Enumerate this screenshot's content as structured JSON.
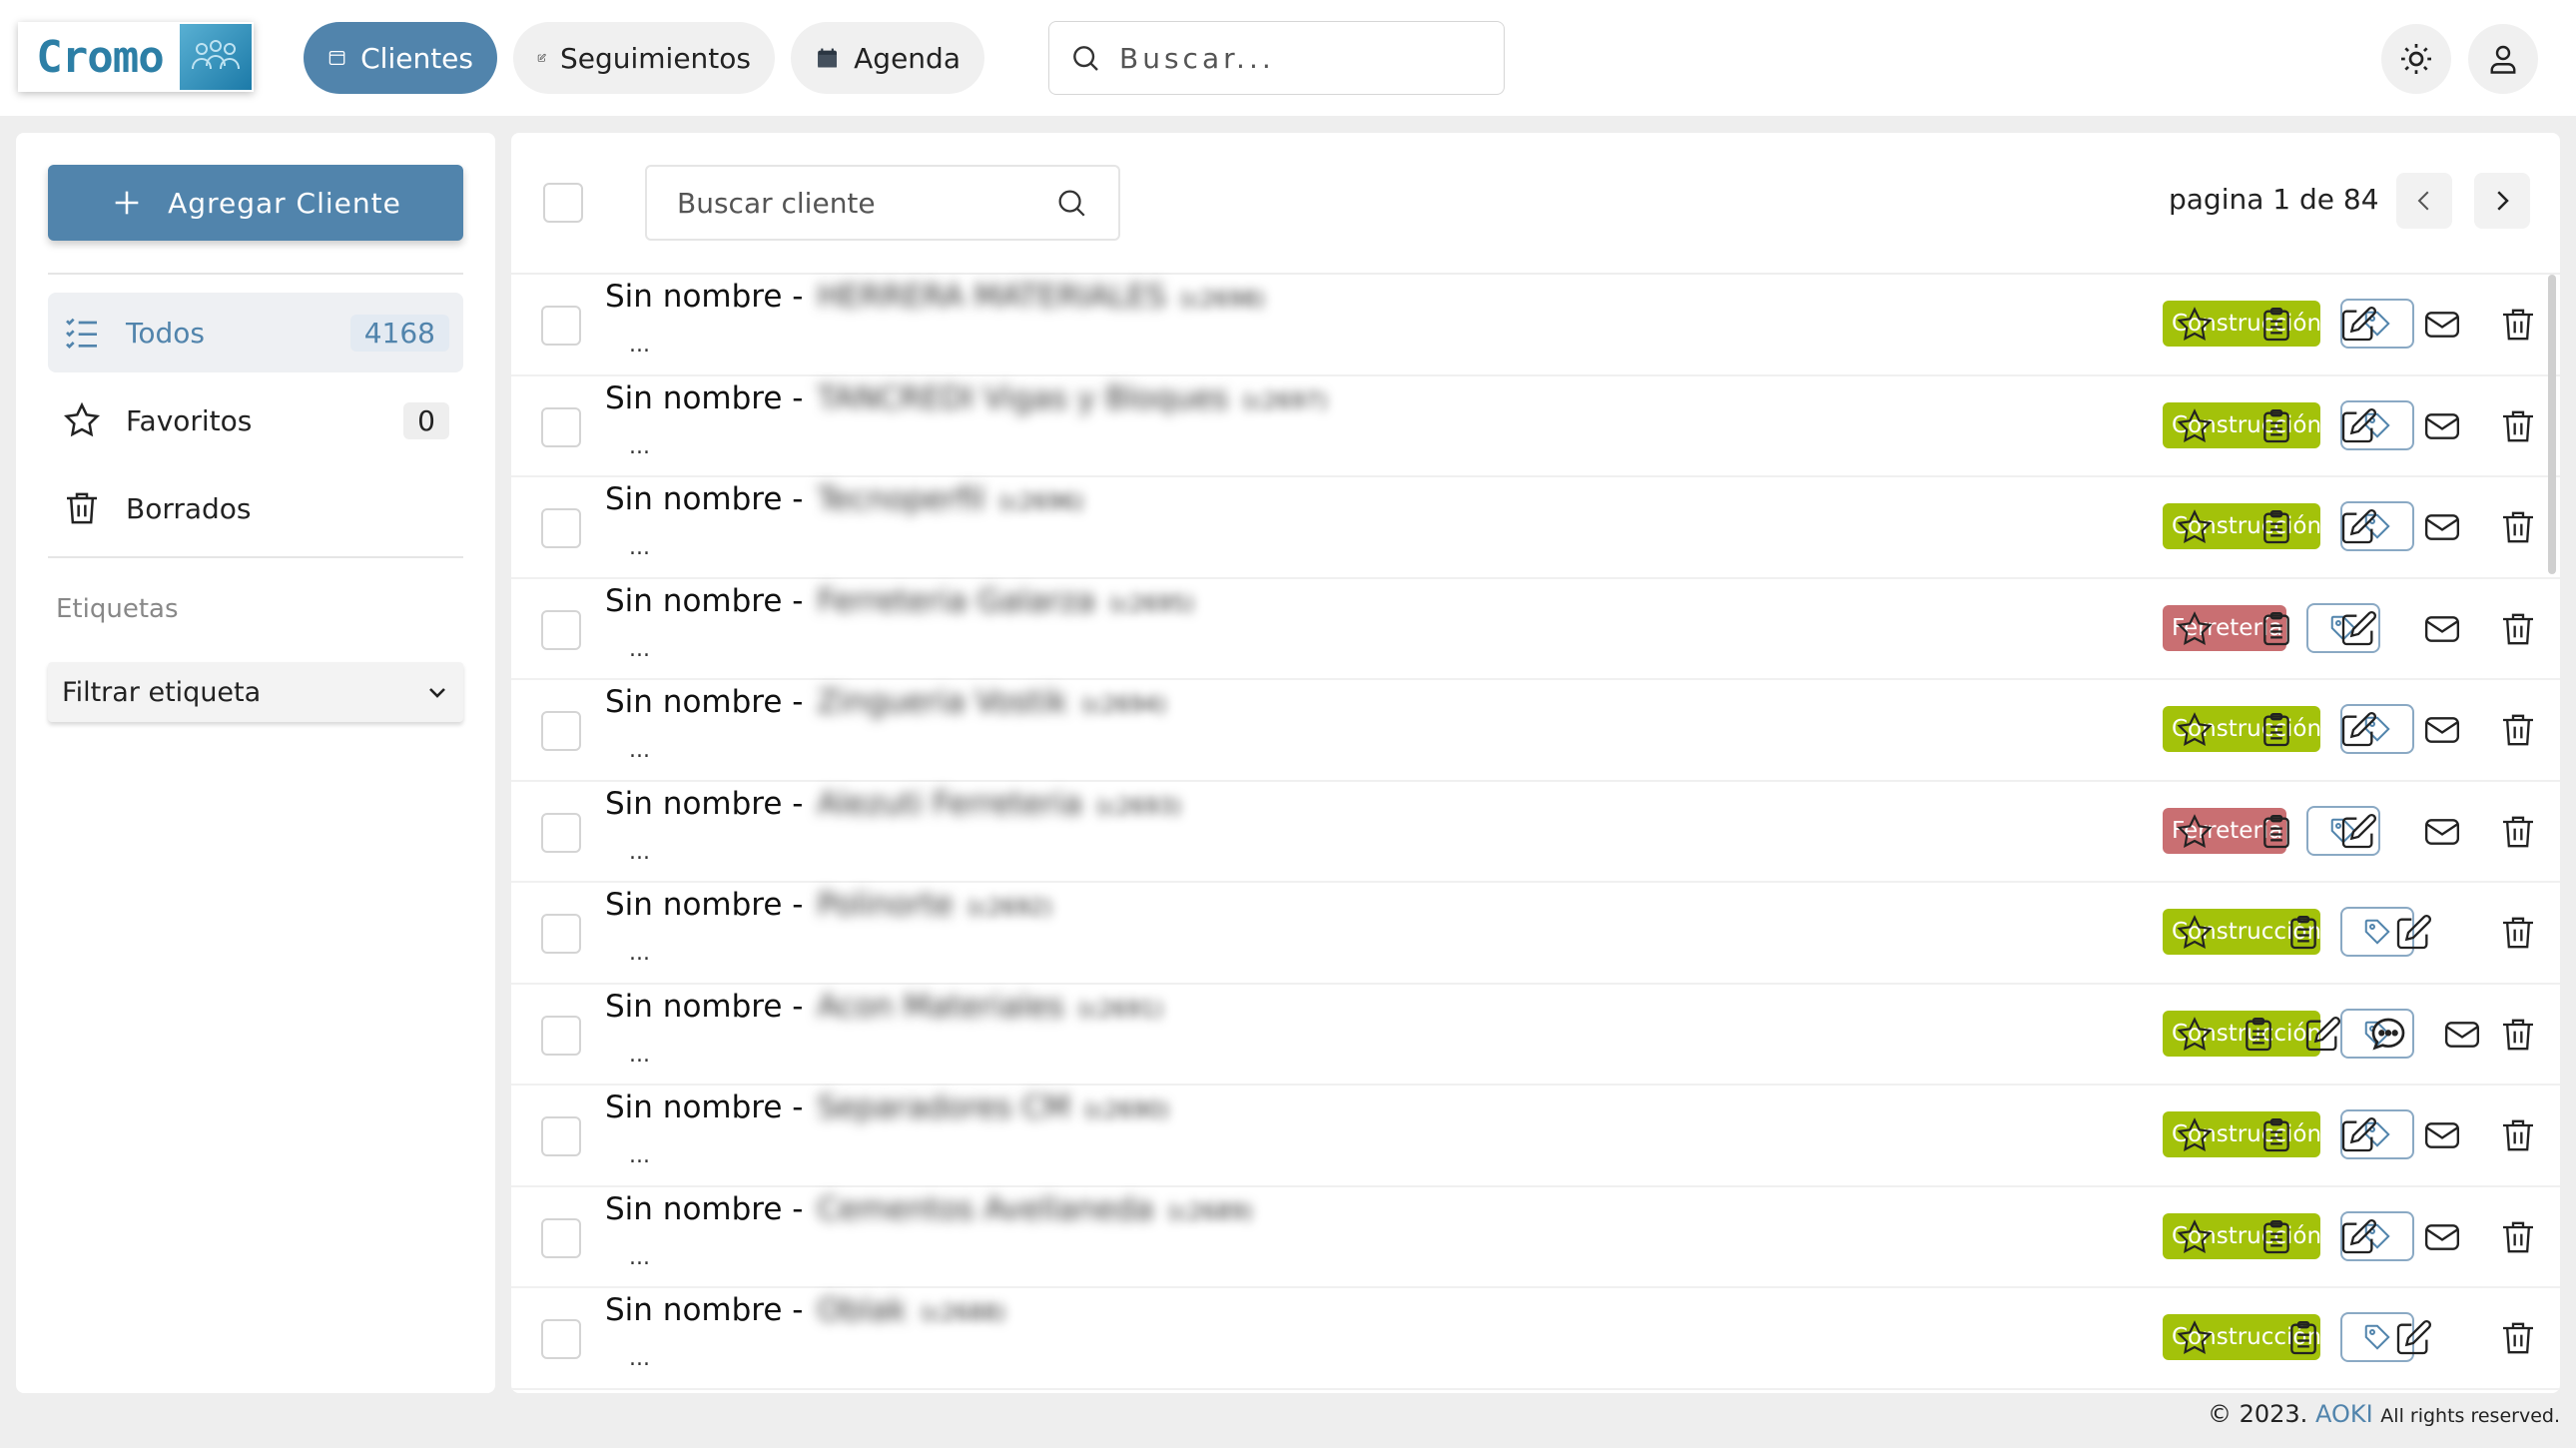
{
  "app": {
    "logo_text": "Cromo",
    "nav": [
      {
        "label": "Clientes",
        "icon": "window-icon",
        "active": true
      },
      {
        "label": "Seguimientos",
        "icon": "edit-square-icon",
        "active": false
      },
      {
        "label": "Agenda",
        "icon": "calendar-icon",
        "active": false
      }
    ],
    "search_placeholder": "Buscar...",
    "accent_color": "#5184ac"
  },
  "sidebar": {
    "add_button": "Agregar Cliente",
    "items": [
      {
        "label": "Todos",
        "count": "4168",
        "icon": "list-check-icon"
      },
      {
        "label": "Favoritos",
        "count": "0",
        "icon": "star-icon"
      },
      {
        "label": "Borrados",
        "icon": "trash-icon"
      }
    ],
    "tags_heading": "Etiquetas",
    "tag_filter": "Filtrar etiqueta"
  },
  "main": {
    "search_placeholder": "Buscar cliente",
    "pagination": "pagina 1 de 84",
    "rows": [
      {
        "prefix": "Sin nombre -",
        "name": "HERRERA MATERIALES",
        "id": "(c2698)",
        "dots": "...",
        "tag": "Construcción"
      },
      {
        "prefix": "Sin nombre -",
        "name": "TANCREDI Vigas y Bloques",
        "id": "(c2697)",
        "dots": "...",
        "tag": "Construcción"
      },
      {
        "prefix": "Sin nombre -",
        "name": "Tecnoperfil",
        "id": "(c2696)",
        "dots": "...",
        "tag": "Construcción"
      },
      {
        "prefix": "Sin nombre -",
        "name": "Ferreteria Galarza",
        "id": "(c2695)",
        "dots": "...",
        "tag": "Ferretería"
      },
      {
        "prefix": "Sin nombre -",
        "name": "Zingueria Vostik",
        "id": "(c2694)",
        "dots": "...",
        "tag": "Construcción"
      },
      {
        "prefix": "Sin nombre -",
        "name": "Alezuti Ferreteria",
        "id": "(c2693)",
        "dots": "...",
        "tag": "Ferretería"
      },
      {
        "prefix": "Sin nombre -",
        "name": "Polinorte",
        "id": "(c2692)",
        "dots": "...",
        "tag": "Construcción"
      },
      {
        "prefix": "Sin nombre -",
        "name": "Acon Materiales",
        "id": "(c2691)",
        "dots": "...",
        "tag": "Construcción"
      },
      {
        "prefix": "Sin nombre -",
        "name": "Separadores CM",
        "id": "(c2690)",
        "dots": "...",
        "tag": "Construcción"
      },
      {
        "prefix": "Sin nombre -",
        "name": "Cementos Avellaneda",
        "id": "(c2689)",
        "dots": "...",
        "tag": "Construcción"
      },
      {
        "prefix": "Sin nombre -",
        "name": "Oblak",
        "id": "(c2688)",
        "dots": "...",
        "tag": "Construcción"
      }
    ],
    "tag_colors": {
      "Construcción": "#a3c20a",
      "Ferretería": "#c96f72"
    }
  },
  "footer": {
    "copyright": "© 2023.",
    "brand": "AOKI",
    "rights": "All rights reserved."
  }
}
